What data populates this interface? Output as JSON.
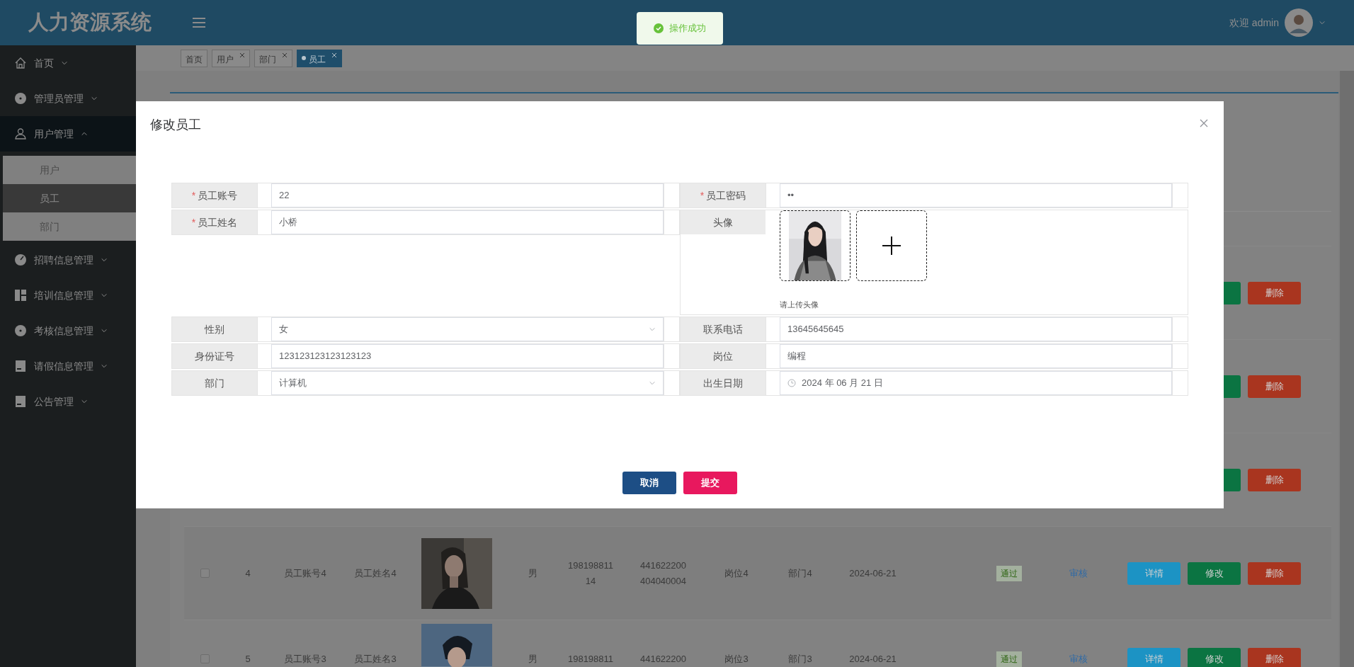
{
  "header": {
    "logo": "人力资源系统",
    "welcome": "欢迎 admin"
  },
  "toast": {
    "kind": "success",
    "text": "操作成功"
  },
  "sidebar": {
    "items": [
      {
        "label": "首页",
        "expanded": false
      },
      {
        "label": "管理员管理",
        "expanded": false
      },
      {
        "label": "用户管理",
        "expanded": true,
        "children": [
          {
            "label": "用户",
            "selected": false
          },
          {
            "label": "员工",
            "selected": true
          },
          {
            "label": "部门",
            "selected": false
          }
        ]
      },
      {
        "label": "招聘信息管理",
        "expanded": false
      },
      {
        "label": "培训信息管理",
        "expanded": false
      },
      {
        "label": "考核信息管理",
        "expanded": false
      },
      {
        "label": "请假信息管理",
        "expanded": false
      },
      {
        "label": "公告管理",
        "expanded": false
      }
    ]
  },
  "tabs": [
    {
      "label": "首页",
      "closable": false,
      "selected": false
    },
    {
      "label": "用户",
      "closable": true,
      "selected": false
    },
    {
      "label": "部门",
      "closable": true,
      "selected": false
    },
    {
      "label": "员工",
      "closable": true,
      "selected": true
    }
  ],
  "table": {
    "rows": [
      {
        "actions": [
          {
            "kind": "edit"
          },
          {
            "label": "删除",
            "kind": "delete"
          }
        ]
      },
      {
        "actions": [
          {
            "kind": "edit"
          },
          {
            "label": "删除",
            "kind": "delete"
          }
        ]
      },
      {
        "actions": [
          {
            "kind": "edit"
          },
          {
            "label": "删除",
            "kind": "delete"
          }
        ]
      },
      {
        "checked": false,
        "id": "4",
        "account": "员工账号4",
        "name": "员工姓名4",
        "photo": {
          "kind": "picture"
        },
        "gender": "男",
        "phone": [
          "198198811",
          "14"
        ],
        "id_card": [
          "441622200",
          "404040004"
        ],
        "post": "岗位4",
        "dept": "部门4",
        "date": "2024-06-21",
        "status": "通过",
        "audit": "审核",
        "actions": [
          {
            "label": "详情",
            "kind": "detail"
          },
          {
            "label": "修改",
            "kind": "edit"
          },
          {
            "label": "删除",
            "kind": "delete"
          }
        ]
      },
      {
        "checked": false,
        "id": "5",
        "account": "员工账号3",
        "name": "员工姓名3",
        "photo": {
          "kind": "picture"
        },
        "gender": "男",
        "phone": [
          "198198811"
        ],
        "id_card": [
          "441622200"
        ],
        "post": "岗位3",
        "dept": "部门3",
        "date": "2024-06-21",
        "status": "通过",
        "audit": "审核",
        "actions": [
          {
            "label": "详情",
            "kind": "detail"
          },
          {
            "label": "修改",
            "kind": "edit"
          },
          {
            "label": "删除",
            "kind": "delete"
          }
        ]
      }
    ]
  },
  "dialog": {
    "title": "修改员工",
    "rows": [
      {
        "left": {
          "required_mark": "*",
          "label": "员工账号",
          "kind": "text",
          "value": "22"
        },
        "right": {
          "required_mark": "*",
          "label": "员工密码",
          "kind": "text",
          "value": "••"
        }
      },
      {
        "left": {
          "required_mark": "*",
          "label": "员工姓名",
          "kind": "text",
          "value": "小桥"
        },
        "right": {
          "label": "头像",
          "kind": "upload",
          "photo": {
            "kind": "picture"
          },
          "hint": "请上传头像"
        }
      },
      {
        "left": {
          "label": "性别",
          "kind": "select",
          "value": "女"
        },
        "right": {
          "label": "联系电话",
          "kind": "text",
          "value": "13645645645"
        }
      },
      {
        "left": {
          "label": "身份证号",
          "kind": "text",
          "value": "123123123123123123"
        },
        "right": {
          "label": "岗位",
          "kind": "text",
          "value": "编程"
        }
      },
      {
        "left": {
          "label": "部门",
          "kind": "select",
          "value": "计算机"
        },
        "right": {
          "label": "出生日期",
          "kind": "date",
          "value": "2024 年 06 月 21 日"
        }
      }
    ],
    "buttons": [
      {
        "label": "取消",
        "kind": "cancel"
      },
      {
        "label": "提交",
        "kind": "submit"
      }
    ]
  }
}
